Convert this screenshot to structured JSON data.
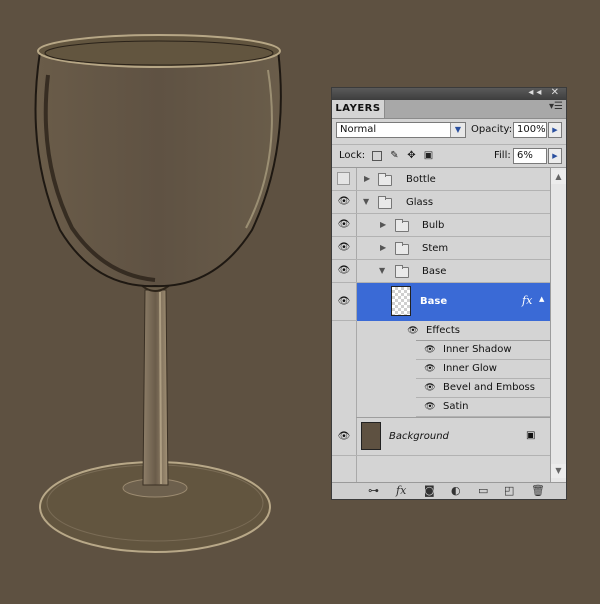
{
  "panel": {
    "tab_label": "LAYERS",
    "collapse_icon": "double-chevron-left-icon",
    "close_icon": "close-icon",
    "blend_mode": "Normal",
    "opacity_label": "Opacity:",
    "opacity_value": "100%",
    "lock_label": "Lock:",
    "fill_label": "Fill:",
    "fill_value": "6%"
  },
  "layers": [
    {
      "name": "Bottle",
      "type": "group",
      "visible": false
    },
    {
      "name": "Glass",
      "type": "group",
      "visible": true,
      "expanded": true
    },
    {
      "name": "Bulb",
      "type": "group",
      "visible": true
    },
    {
      "name": "Stem",
      "type": "group",
      "visible": true
    },
    {
      "name": "Base",
      "type": "group",
      "visible": true,
      "expanded": true
    },
    {
      "name": "Base",
      "type": "layer",
      "visible": true,
      "selected": true,
      "fx_label": "fx"
    },
    {
      "name": "Background",
      "type": "background",
      "visible": true,
      "locked": true
    }
  ],
  "effects": {
    "header": "Effects",
    "items": [
      "Inner Shadow",
      "Inner Glow",
      "Bevel and Emboss",
      "Satin"
    ]
  },
  "bottom_bar_icons": [
    "link-icon",
    "fx-icon",
    "mask-icon",
    "adjustment-icon",
    "new-group-icon",
    "new-layer-icon",
    "trash-icon"
  ],
  "colors": {
    "canvas_background": "#5e5141",
    "selection": "#3a6ad6"
  }
}
